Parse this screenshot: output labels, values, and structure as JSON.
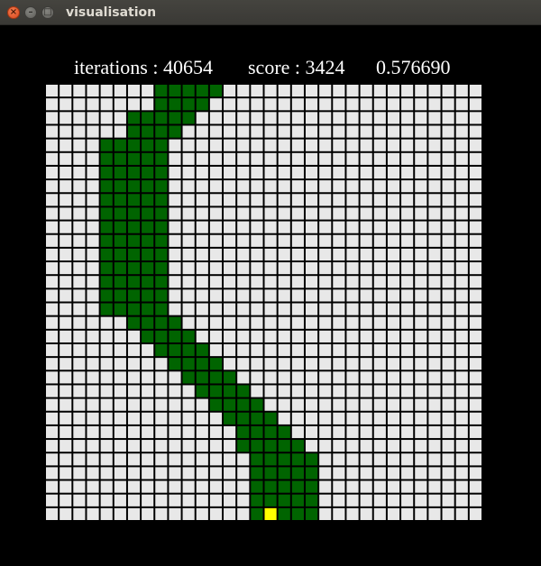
{
  "window": {
    "title": "visualisation",
    "buttons": {
      "close": "×",
      "minimize": "–",
      "maximize": "□"
    }
  },
  "hud": {
    "iterations": "iterations : 40654",
    "score": "score : 3424",
    "value": "0.576690"
  },
  "colors": {
    "background": "#000000",
    "empty": "#e8e8e8",
    "snake": "#006400",
    "food": "#ffff00",
    "gridline": "#000000"
  },
  "board": {
    "cols": 32,
    "rows": 32,
    "food": [
      16,
      31
    ],
    "snake_rows": [
      [
        8,
        12
      ],
      [
        8,
        11
      ],
      [
        6,
        10
      ],
      [
        6,
        9
      ],
      [
        4,
        8
      ],
      [
        4,
        8
      ],
      [
        4,
        8
      ],
      [
        4,
        8
      ],
      [
        4,
        8
      ],
      [
        4,
        8
      ],
      [
        4,
        8
      ],
      [
        4,
        8
      ],
      [
        4,
        8
      ],
      [
        4,
        8
      ],
      [
        4,
        8
      ],
      [
        4,
        8
      ],
      [
        4,
        8
      ],
      [
        6,
        9
      ],
      [
        7,
        10
      ],
      [
        8,
        11
      ],
      [
        9,
        12
      ],
      [
        10,
        13
      ],
      [
        11,
        14
      ],
      [
        12,
        15
      ],
      [
        13,
        16
      ],
      [
        14,
        17
      ],
      [
        14,
        18
      ],
      [
        15,
        19
      ],
      [
        15,
        19
      ],
      [
        15,
        19
      ],
      [
        15,
        19
      ],
      [
        15,
        19
      ]
    ]
  }
}
